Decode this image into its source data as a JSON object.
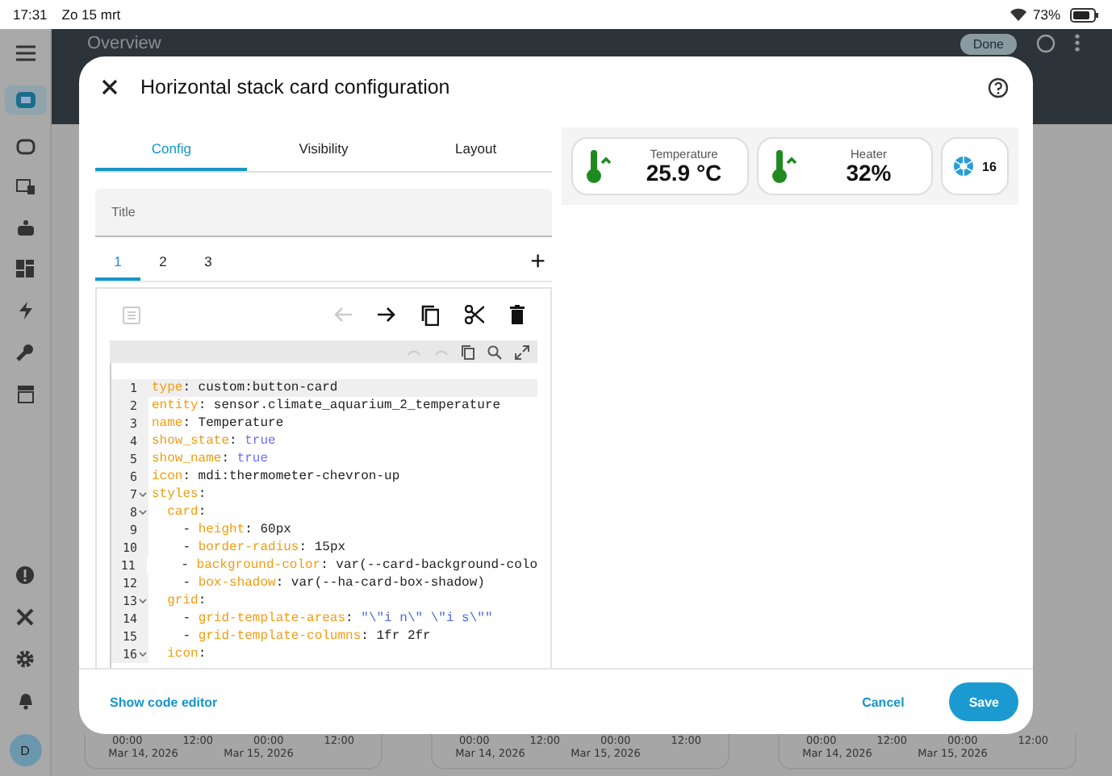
{
  "status_bar": {
    "time": "17:31",
    "date": "Zo 15 mrt",
    "battery": "73%"
  },
  "header": {
    "title": "Overview",
    "action": "Done"
  },
  "sidebar": {
    "avatar": "D"
  },
  "background_charts": [
    {
      "ticks": [
        "00:00",
        "12:00",
        "00:00",
        "12:00"
      ],
      "dates": [
        "Mar 14, 2026",
        "Mar 15, 2026"
      ]
    },
    {
      "ticks": [
        "00:00",
        "12:00",
        "00:00",
        "12:00"
      ],
      "dates": [
        "Mar 14, 2026",
        "Mar 15, 2026"
      ]
    },
    {
      "ticks": [
        "00:00",
        "12:00",
        "00:00",
        "12:00"
      ],
      "dates": [
        "Mar 14, 2026",
        "Mar 15, 2026"
      ]
    }
  ],
  "dialog": {
    "title": "Horizontal stack card configuration",
    "tabs": [
      {
        "label": "Config",
        "selected": true
      },
      {
        "label": "Visibility",
        "selected": false
      },
      {
        "label": "Layout",
        "selected": false
      }
    ],
    "title_field": {
      "placeholder": "Title"
    },
    "card_tabs": [
      {
        "label": "1",
        "selected": true
      },
      {
        "label": "2",
        "selected": false
      },
      {
        "label": "3",
        "selected": false
      }
    ],
    "add_label": "+",
    "code_lines": [
      {
        "number": "1",
        "foldable": false,
        "active": true,
        "tokens": [
          {
            "text": "type",
            "kind": "key"
          },
          {
            "text": ": custom:button-card",
            "kind": "plain"
          }
        ]
      },
      {
        "number": "2",
        "foldable": false,
        "active": false,
        "tokens": [
          {
            "text": "entity",
            "kind": "key"
          },
          {
            "text": ": sensor.climate_aquarium_2_temperature",
            "kind": "plain"
          }
        ]
      },
      {
        "number": "3",
        "foldable": false,
        "active": false,
        "tokens": [
          {
            "text": "name",
            "kind": "key"
          },
          {
            "text": ": Temperature",
            "kind": "plain"
          }
        ]
      },
      {
        "number": "4",
        "foldable": false,
        "active": false,
        "tokens": [
          {
            "text": "show_state",
            "kind": "key"
          },
          {
            "text": ": ",
            "kind": "plain"
          },
          {
            "text": "true",
            "kind": "bool"
          }
        ]
      },
      {
        "number": "5",
        "foldable": false,
        "active": false,
        "tokens": [
          {
            "text": "show_name",
            "kind": "key"
          },
          {
            "text": ": ",
            "kind": "plain"
          },
          {
            "text": "true",
            "kind": "bool"
          }
        ]
      },
      {
        "number": "6",
        "foldable": false,
        "active": false,
        "tokens": [
          {
            "text": "icon",
            "kind": "key"
          },
          {
            "text": ": mdi:thermometer-chevron-up",
            "kind": "plain"
          }
        ]
      },
      {
        "number": "7",
        "foldable": true,
        "active": false,
        "tokens": [
          {
            "text": "styles",
            "kind": "key"
          },
          {
            "text": ":",
            "kind": "plain"
          }
        ]
      },
      {
        "number": "8",
        "foldable": true,
        "active": false,
        "tokens": [
          {
            "text": "  card",
            "kind": "key"
          },
          {
            "text": ":",
            "kind": "plain"
          }
        ]
      },
      {
        "number": "9",
        "foldable": false,
        "active": false,
        "tokens": [
          {
            "text": "    - ",
            "kind": "plain"
          },
          {
            "text": "height",
            "kind": "key"
          },
          {
            "text": ": 60px",
            "kind": "plain"
          }
        ]
      },
      {
        "number": "10",
        "foldable": false,
        "active": false,
        "tokens": [
          {
            "text": "    - ",
            "kind": "plain"
          },
          {
            "text": "border-radius",
            "kind": "key"
          },
          {
            "text": ": 15px",
            "kind": "plain"
          }
        ]
      },
      {
        "number": "11",
        "foldable": false,
        "active": false,
        "tokens": [
          {
            "text": "    - ",
            "kind": "plain"
          },
          {
            "text": "background-color",
            "kind": "key"
          },
          {
            "text": ": var(--card-background-colo",
            "kind": "plain"
          }
        ]
      },
      {
        "number": "12",
        "foldable": false,
        "active": false,
        "tokens": [
          {
            "text": "    - ",
            "kind": "plain"
          },
          {
            "text": "box-shadow",
            "kind": "key"
          },
          {
            "text": ": var(--ha-card-box-shadow)",
            "kind": "plain"
          }
        ]
      },
      {
        "number": "13",
        "foldable": true,
        "active": false,
        "tokens": [
          {
            "text": "  grid",
            "kind": "key"
          },
          {
            "text": ":",
            "kind": "plain"
          }
        ]
      },
      {
        "number": "14",
        "foldable": false,
        "active": false,
        "tokens": [
          {
            "text": "    - ",
            "kind": "plain"
          },
          {
            "text": "grid-template-areas",
            "kind": "key"
          },
          {
            "text": ": ",
            "kind": "plain"
          },
          {
            "text": "\"\\\"i n\\\" \\\"i s\\\"\"",
            "kind": "string"
          }
        ]
      },
      {
        "number": "15",
        "foldable": false,
        "active": false,
        "tokens": [
          {
            "text": "    - ",
            "kind": "plain"
          },
          {
            "text": "grid-template-columns",
            "kind": "key"
          },
          {
            "text": ": 1fr 2fr",
            "kind": "plain"
          }
        ]
      },
      {
        "number": "16",
        "foldable": true,
        "active": false,
        "tokens": [
          {
            "text": "  icon",
            "kind": "key"
          },
          {
            "text": ":",
            "kind": "plain"
          }
        ]
      }
    ],
    "preview_cards": [
      {
        "kind": "sensor",
        "name": "Temperature",
        "state": "25.9 °C"
      },
      {
        "kind": "sensor",
        "name": "Heater",
        "state": "32%"
      },
      {
        "kind": "badge",
        "state": "16"
      }
    ],
    "footer": {
      "link": "Show code editor",
      "cancel": "Cancel",
      "save": "Save"
    }
  }
}
